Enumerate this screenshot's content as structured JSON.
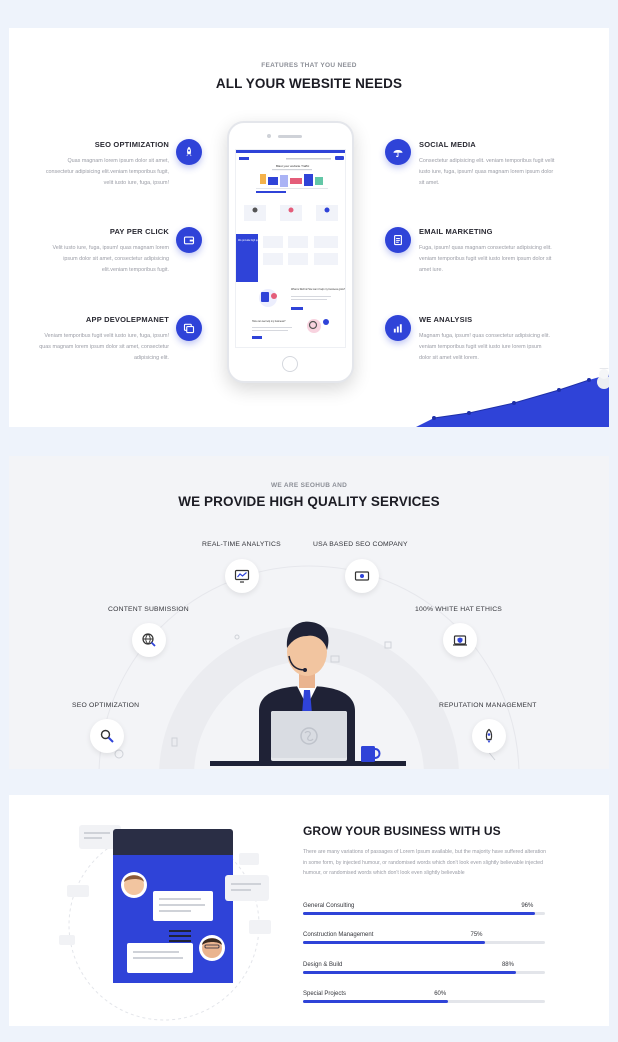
{
  "features": {
    "eyebrow": "FEATURES THAT YOU NEED",
    "heading": "ALL YOUR WEBSITE NEEDS",
    "left": [
      {
        "title": "SEO OPTIMIZATION",
        "desc": "Quas magnam lorem ipsum dolor sit amet, consectetur adipisicing elit.veniam temporibus fugit, velit iusto iure, fuga, ipsum!",
        "icon": "rocket-icon"
      },
      {
        "title": "PAY PER CLICK",
        "desc": "Velit iusto iure, fuga, ipsum! quas magnam lorem ipsum dolor sit amet, consectetur adipisicing elit.veniam temporibus fugit.",
        "icon": "wallet-icon"
      },
      {
        "title": "APP DEVOLEPMANET",
        "desc": "Veniam temporibus fugit velit iusto iure, fuga, ipsum! quas magnam lorem ipsum dolor sit amet, consectetur adipisicing elit.",
        "icon": "app-window-icon"
      }
    ],
    "right": [
      {
        "title": "SOCIAL MEDIA",
        "desc": "Consectetur adipisicing elit. veniam temporibus fugit velit iusto iure, fuga, ipsum! quas magnam lorem ipsum dolor sit amet.",
        "icon": "umbrella-icon"
      },
      {
        "title": "EMAIL MARKETING",
        "desc": "Fuga, ipsum! quas magnam consectetur adipisicing elit. veniam temporibus fugit velit iusto lorem ipsum dolor sit amet iure.",
        "icon": "document-icon"
      },
      {
        "title": "WE ANALYSIS",
        "desc": "Magnam fuga, ipsum! quas consectetur adipisicing elit. veniam temporibus fugit velit iusto iure lorem ipsum dolor sit amet velit lorem.",
        "icon": "bar-chart-icon"
      }
    ]
  },
  "phone_screen": {
    "brand": "SeoHub",
    "hero_title": "Blast your website Traffic",
    "promo_title": "We provide high quality service",
    "analysis_title": "What is SEO & How can it help my business grow?",
    "seo_title": "How can we help my business?"
  },
  "services": {
    "eyebrow": "WE ARE SEOHUB AND",
    "heading": "WE PROVIDE HIGH QUALITY SERVICES",
    "items": [
      {
        "label": "REAL-TIME ANALYTICS",
        "icon": "monitor-chart-icon"
      },
      {
        "label": "USA BASED SEO COMPANY",
        "icon": "money-icon"
      },
      {
        "label": "CONTENT SUBMISSION",
        "icon": "globe-search-icon"
      },
      {
        "label": "100% WHITE HAT ETHICS",
        "icon": "shield-laptop-icon"
      },
      {
        "label": "SEO OPTIMIZATION",
        "icon": "magnifier-icon"
      },
      {
        "label": "REPUTATION MANAGEMENT",
        "icon": "rocket-icon"
      }
    ]
  },
  "grow": {
    "title": "GROW YOUR BUSINESS WITH US",
    "text": "There are many variations of passages of Lorem Ipsum available, but the majority have suffered alteration in some form, by injected humour, or randomised words which don't look even slightly believable injected humour, or randomised words which don't look even slightly believable",
    "progress": [
      {
        "label": "General Consulting",
        "value": 96,
        "text": "96%"
      },
      {
        "label": "Construction Management",
        "value": 75,
        "text": "75%"
      },
      {
        "label": "Design & Build",
        "value": 88,
        "text": "88%"
      },
      {
        "label": "Special Projects",
        "value": 60,
        "text": "60%"
      }
    ]
  },
  "colors": {
    "accent": "#2f43d8",
    "track": "#e3e5ea"
  }
}
